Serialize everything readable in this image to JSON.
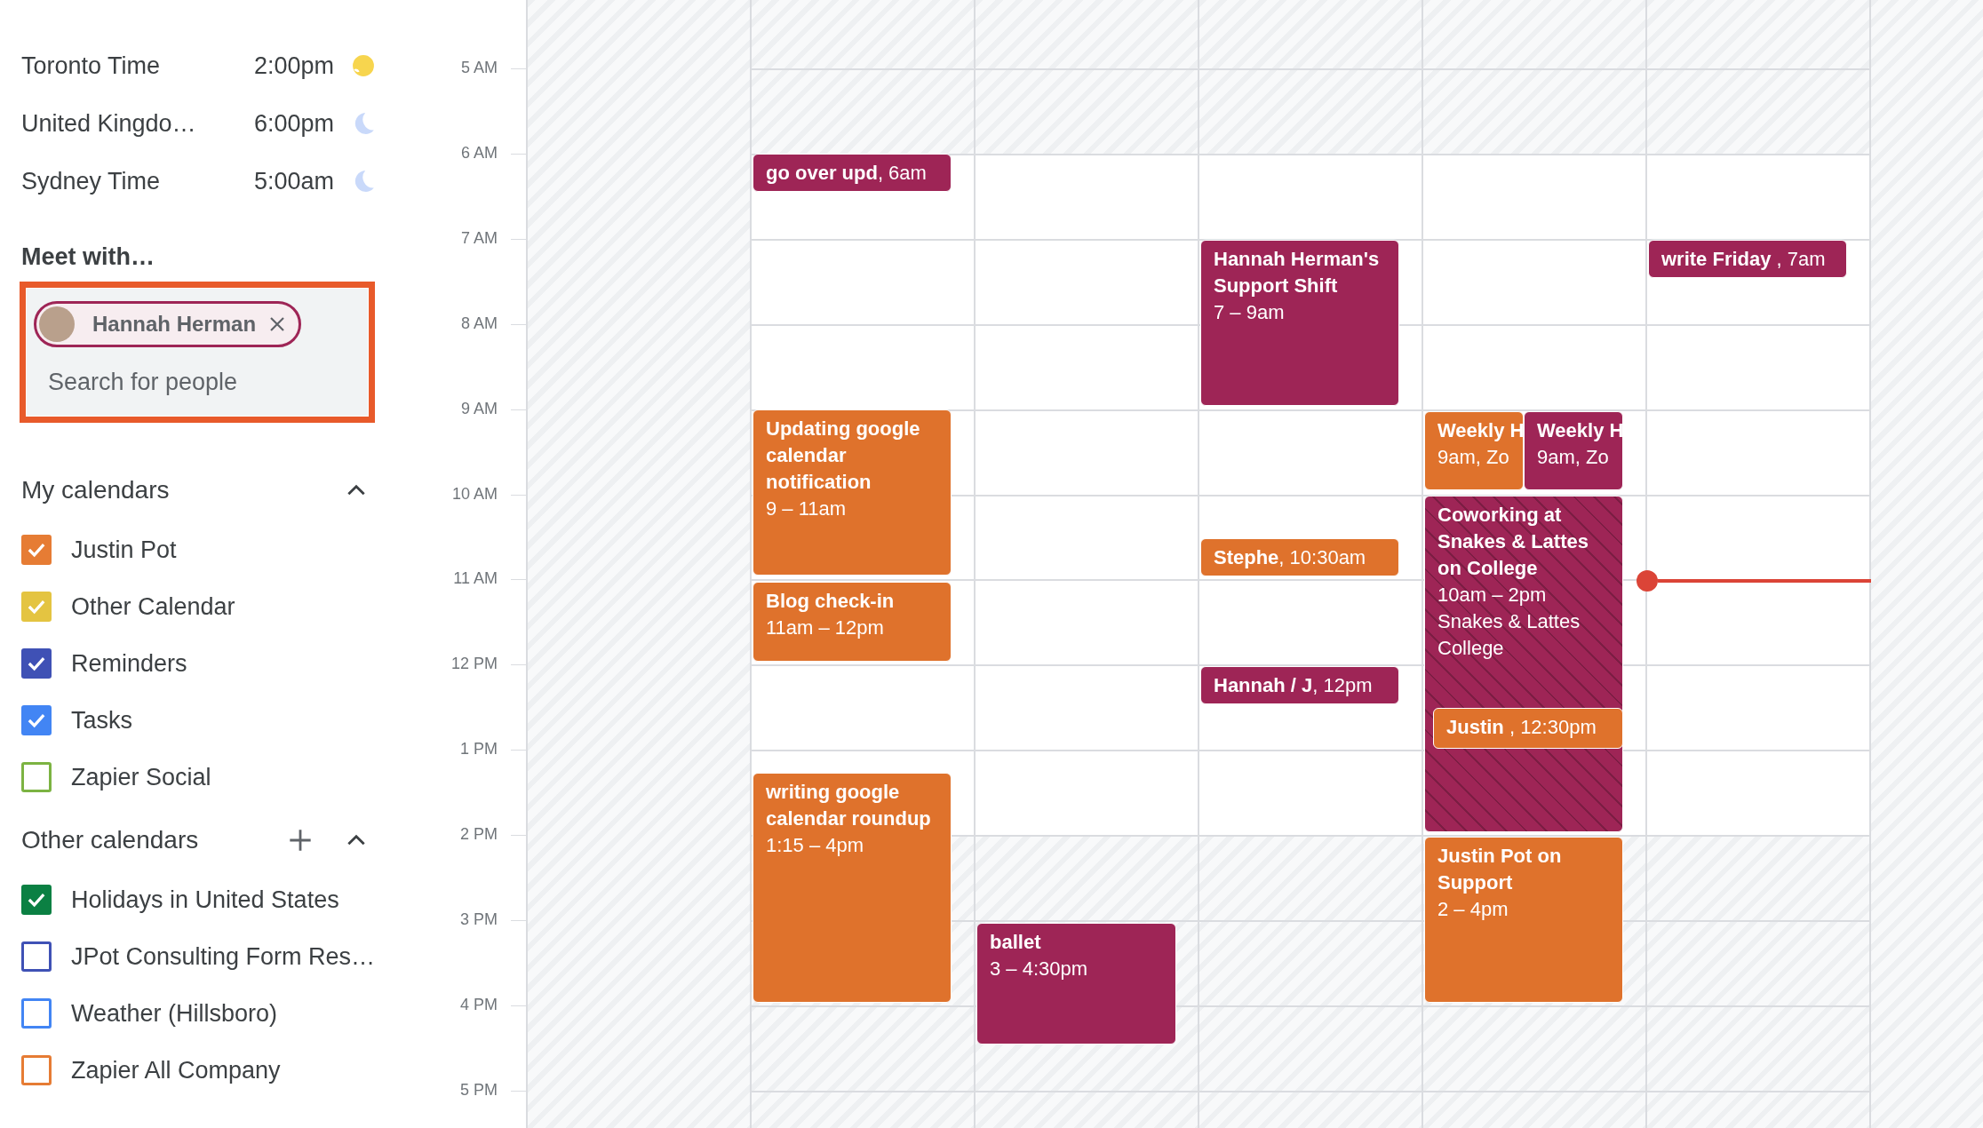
{
  "world_clocks": [
    {
      "name": "Toronto Time",
      "time": "2:00pm",
      "kind": "day"
    },
    {
      "name": "United Kingdo…",
      "time": "6:00pm",
      "kind": "night"
    },
    {
      "name": "Sydney Time",
      "time": "5:00am",
      "kind": "night"
    }
  ],
  "meet_with": {
    "heading": "Meet with…",
    "people": [
      {
        "name": "Hannah Herman"
      }
    ],
    "search": {
      "placeholder": "Search for people"
    }
  },
  "my_calendars": {
    "heading": "My calendars",
    "expanded": true,
    "items": [
      {
        "name": "Justin Pot",
        "checked": true,
        "color": "#e67c34"
      },
      {
        "name": "Other Calendar",
        "checked": true,
        "color": "#e4c441"
      },
      {
        "name": "Reminders",
        "checked": true,
        "color": "#3f51b5"
      },
      {
        "name": "Tasks",
        "checked": true,
        "color": "#4285f4"
      },
      {
        "name": "Zapier Social",
        "checked": false,
        "color": "#7cb342"
      }
    ]
  },
  "other_calendars": {
    "heading": "Other calendars",
    "expanded": true,
    "items": [
      {
        "name": "Holidays in United States",
        "checked": true,
        "color": "#0b8043"
      },
      {
        "name": "JPot Consulting Form Res…",
        "checked": false,
        "color": "#3f51b5"
      },
      {
        "name": "Weather (Hillsboro)",
        "checked": false,
        "color": "#4285f4"
      },
      {
        "name": "Zapier All Company",
        "checked": false,
        "color": "#e67c34"
      }
    ]
  },
  "time_axis": {
    "labels": [
      "5 AM",
      "6 AM",
      "7 AM",
      "8 AM",
      "9 AM",
      "10 AM",
      "11 AM",
      "12 PM",
      "1 PM",
      "2 PM",
      "3 PM",
      "4 PM",
      "5 PM"
    ]
  },
  "days": [
    {
      "events": [
        {
          "kind": "chip",
          "color": "#9e2556",
          "text": "**go over upd**, 6am"
        },
        {
          "kind": "block",
          "color": "#df722c",
          "title": "Updating google calendar notification",
          "time": "9 – 11am"
        },
        {
          "kind": "block",
          "color": "#df722c",
          "title": "Blog check-in",
          "time": "11am – 12pm"
        },
        {
          "kind": "block",
          "color": "#df722c",
          "title": "writing google calendar roundup",
          "time": "1:15 – 4pm"
        }
      ]
    },
    {
      "events": [
        {
          "kind": "block",
          "color": "#9e2556",
          "title": "ballet",
          "time": "3 – 4:30pm"
        }
      ]
    },
    {
      "events": [
        {
          "kind": "block",
          "color": "#9e2556",
          "title": "Hannah Herman's Support Shift",
          "time": "7 – 9am"
        },
        {
          "kind": "chip",
          "color": "#df722c",
          "text": "**Stephe**, 10:30am"
        },
        {
          "kind": "chip",
          "color": "#9e2556",
          "text": "**Hannah / J**, 12pm"
        }
      ]
    },
    {
      "events": [
        {
          "kind": "block",
          "color": "#df722c",
          "title": "Weekly H",
          "time": "9am, Zo"
        },
        {
          "kind": "block",
          "color": "#9e2556",
          "title": "Weekly H",
          "time": "9am, Zo"
        },
        {
          "kind": "striped",
          "color": "#9e2556",
          "title": "Coworking at Snakes & Lattes on College",
          "time": "10am – 2pm",
          "location": "Snakes & Lattes College"
        },
        {
          "kind": "chip",
          "color": "#df722c",
          "text": "**Justin** , 12:30pm"
        },
        {
          "kind": "block",
          "color": "#df722c",
          "title": "Justin Pot on Support",
          "time": "2 – 4pm"
        }
      ]
    },
    {
      "events": [
        {
          "kind": "chip",
          "color": "#9e2556",
          "text": "**write Friday** , 7am"
        }
      ]
    }
  ]
}
